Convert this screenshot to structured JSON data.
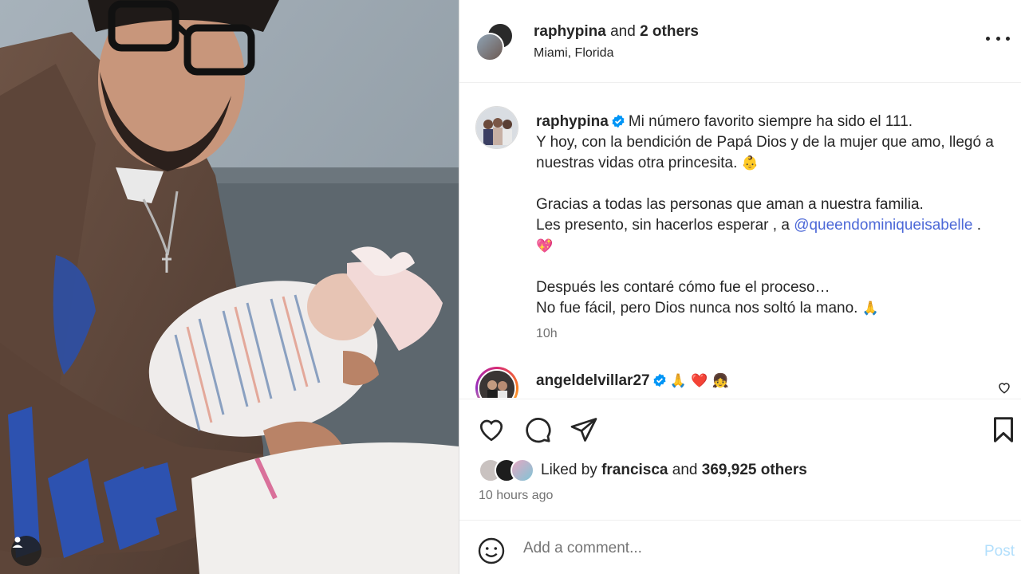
{
  "header": {
    "username": "raphypina",
    "collab_text": "and",
    "collab_count": "2 others",
    "location": "Miami, Florida"
  },
  "caption": {
    "username": "raphypina",
    "line1": "Mi número favorito siempre ha sido el 111.",
    "line2": "Y hoy, con la bendición de Papá Dios y de la mujer que amo, llegó a",
    "line3": "nuestras vidas otra princesita.",
    "emoji_baby": "👶",
    "line4": "Gracias a todas las personas que aman a nuestra familia.",
    "line5": "Les presento, sin hacerlos esperar , a",
    "mention": "@queendominiqueisabelle",
    "line5_end": ".",
    "emoji_heart": "💖",
    "line6": "Después les contaré cómo fue el proceso…",
    "line7": "No fue fácil, pero Dios nunca nos soltó la mano.",
    "emoji_pray": "🙏",
    "time": "10h"
  },
  "comment2": {
    "username": "angeldelvillar27",
    "emojis": "🙏 ❤️ 👧"
  },
  "likes": {
    "prefix": "Liked by",
    "user": "francisca",
    "mid": "and",
    "count": "369,925 others"
  },
  "posted_ago": "10 hours ago",
  "add_comment": {
    "placeholder": "Add a comment...",
    "post_label": "Post"
  },
  "colors": {
    "link": "#4c68d7",
    "verified": "#0095f6",
    "post_disabled": "#b2dffc",
    "muted": "#737373"
  }
}
